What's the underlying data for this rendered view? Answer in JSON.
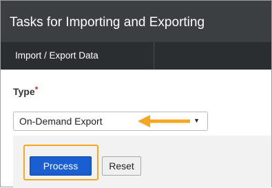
{
  "header": {
    "title": "Tasks for Importing and Exporting"
  },
  "tabs": [
    {
      "label": "Import / Export Data"
    }
  ],
  "form": {
    "type_label": "Type",
    "required_marker": "*",
    "type_selected": "On-Demand Export"
  },
  "actions": {
    "process_label": "Process",
    "reset_label": "Reset"
  },
  "colors": {
    "header": "#3c3f42",
    "tabbar": "#2b2e31",
    "primary_button": "#1a5fd1",
    "annotation": "#f5a623",
    "required": "#c62828"
  },
  "icons": {
    "caret": "chevron-down-icon",
    "annotation_arrow": "arrow-left-icon"
  }
}
